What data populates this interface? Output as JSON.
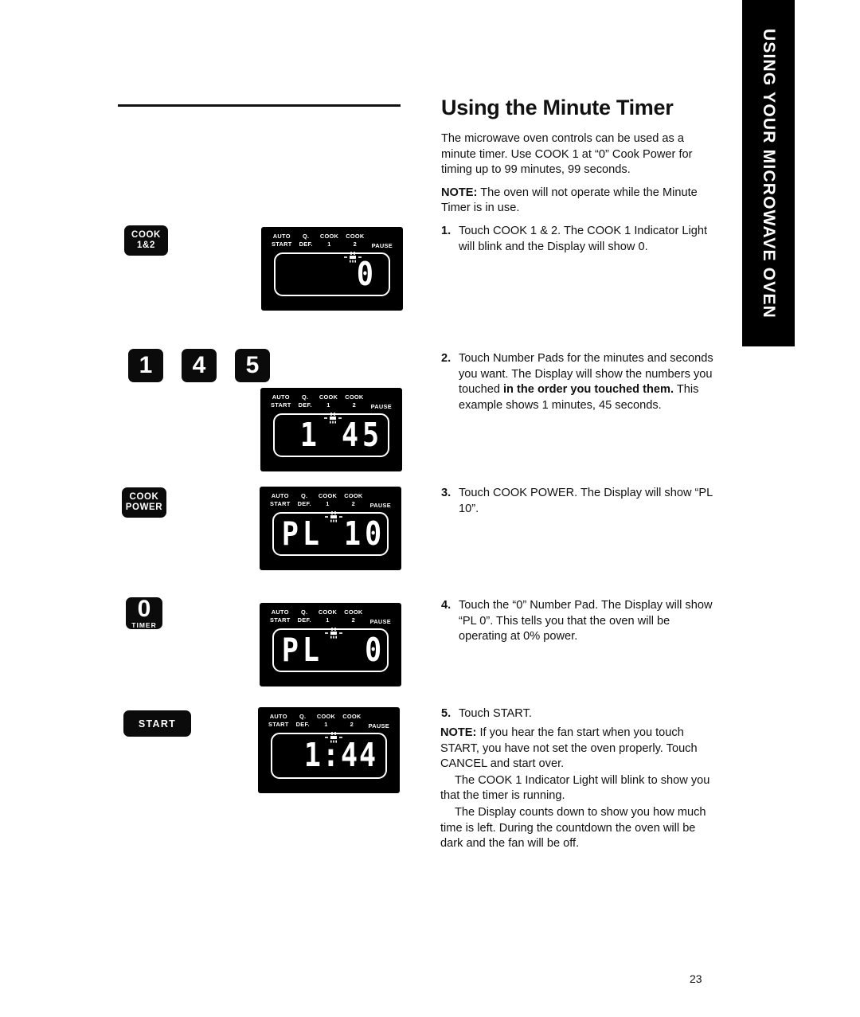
{
  "sidebar_tab": {
    "label": "USING YOUR MICROWAVE OVEN"
  },
  "page_number": "23",
  "heading": "Using the Minute Timer",
  "intro": [
    "The microwave oven controls can be used as a minute timer. Use COOK 1 at “0” Cook Power for timing up to 99 minutes, 99 seconds."
  ],
  "note_label": "NOTE:",
  "note_text": " The oven will not operate while the Minute Timer is in use.",
  "steps": [
    {
      "num": "1.",
      "text": "Touch COOK 1 & 2. The COOK 1 Indicator Light will blink and the Display will show 0."
    },
    {
      "num": "2.",
      "text_a": "Touch Number Pads for the minutes and seconds you want. The Display will show the numbers you touched ",
      "bold": "in the order you touched them.",
      "text_b": " This example shows 1 minutes, 45 seconds."
    },
    {
      "num": "3.",
      "text": "Touch COOK POWER. The Display will show “PL 10”."
    },
    {
      "num": "4.",
      "text": "Touch the “0” Number Pad. The Display will show “PL 0”. This tells you that the oven will be operating at 0% power."
    },
    {
      "num": "5.",
      "text": "Touch START."
    }
  ],
  "final_note": {
    "label": "NOTE:",
    "text": " If you hear the fan start when you touch START, you have not set the oven properly. Touch CANCEL and start over.",
    "para2": "The COOK 1 Indicator Light will blink to show you that the timer is running.",
    "para3": "The Display counts down to show you how much time is left. During the countdown the oven will be dark and the fan will be off."
  },
  "keys": [
    {
      "name": "cook-1-2",
      "line1": "COOK",
      "line2": "1&2"
    },
    {
      "name": "pad-1",
      "line1": "1",
      "line2": ""
    },
    {
      "name": "pad-4",
      "line1": "4",
      "line2": ""
    },
    {
      "name": "pad-5",
      "line1": "5",
      "line2": ""
    },
    {
      "name": "cook-power",
      "line1": "COOK",
      "line2": "POWER"
    },
    {
      "name": "pad-0-timer",
      "line1": "0",
      "line2": "TIMER"
    },
    {
      "name": "start",
      "line1": "START",
      "line2": ""
    }
  ],
  "display_tags": {
    "auto_start": "AUTO\nSTART",
    "q_def": "Q.\nDEF.",
    "cook_1": "COOK\n1",
    "cook_2": "COOK\n2",
    "pause": "PAUSE"
  },
  "displays": [
    {
      "name": "display-step-1",
      "value": "0"
    },
    {
      "name": "display-step-2",
      "value": "1 45"
    },
    {
      "name": "display-step-3",
      "value": "PL 10"
    },
    {
      "name": "display-step-4",
      "value": "PL  0"
    },
    {
      "name": "display-step-5",
      "value": "1:44"
    }
  ],
  "colors": {
    "ink": "#111111",
    "panel": "#000000",
    "panel_text": "#ffffff"
  }
}
